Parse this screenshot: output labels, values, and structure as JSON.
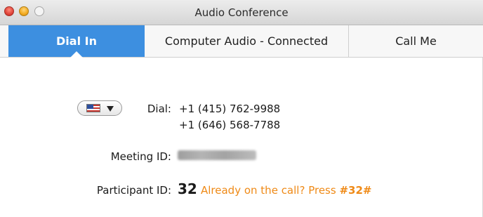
{
  "window": {
    "title": "Audio Conference"
  },
  "tabs": [
    {
      "label": "Dial In",
      "active": true
    },
    {
      "label": "Computer Audio - Connected",
      "active": false
    },
    {
      "label": "Call Me",
      "active": false
    }
  ],
  "country_selector": {
    "icon": "us-flag-icon",
    "caret": "chevron-down-icon"
  },
  "dial": {
    "label": "Dial:",
    "numbers": [
      "+1 (415) 762-9988",
      "+1 (646) 568-7788"
    ]
  },
  "meeting": {
    "label": "Meeting ID:",
    "value_obscured": true
  },
  "participant": {
    "label": "Participant ID:",
    "id": "32",
    "hint_prefix": "Already on the call? Press ",
    "hint_code": "#32#"
  },
  "colors": {
    "accent": "#3d8fe0",
    "hint": "#ef8a17"
  }
}
